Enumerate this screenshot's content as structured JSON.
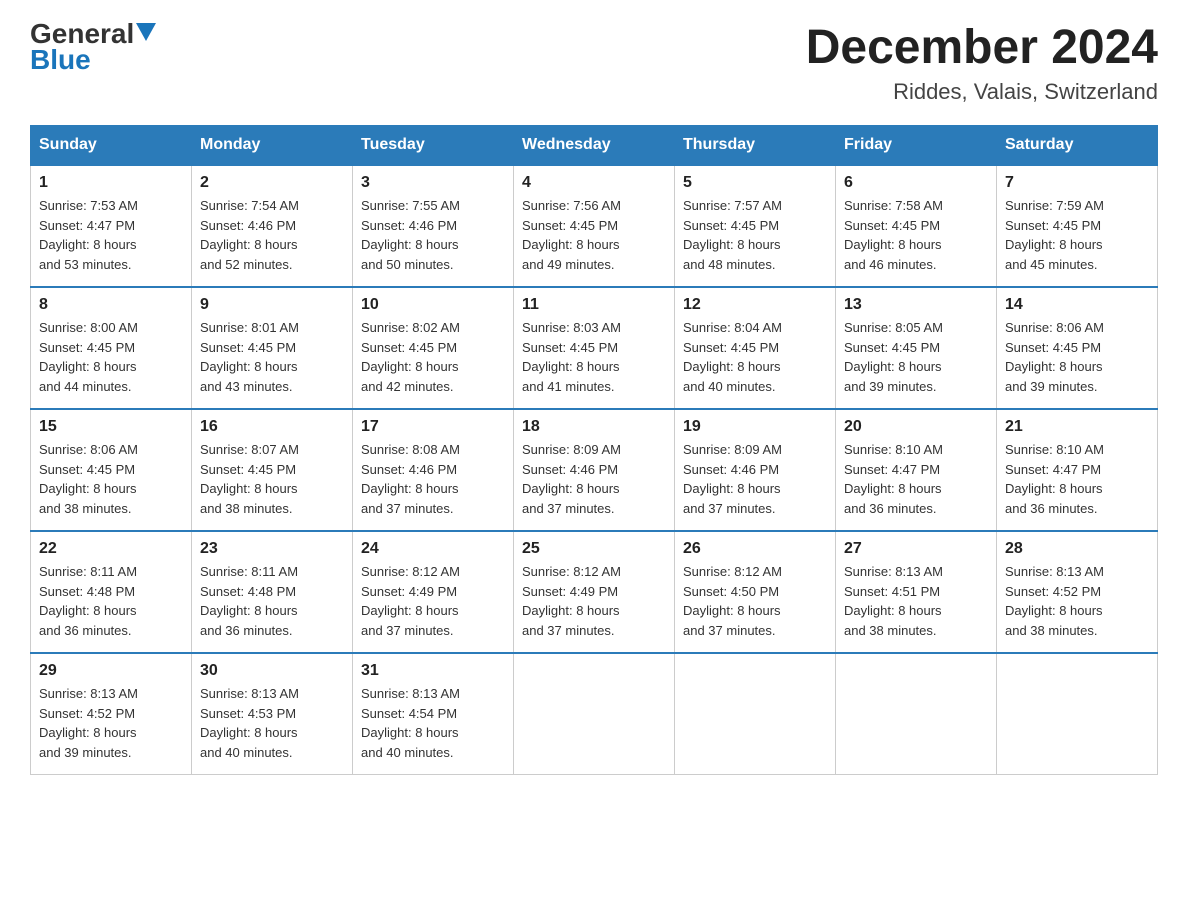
{
  "header": {
    "logo_general": "General",
    "logo_blue": "Blue",
    "month_title": "December 2024",
    "location": "Riddes, Valais, Switzerland"
  },
  "days_of_week": [
    "Sunday",
    "Monday",
    "Tuesday",
    "Wednesday",
    "Thursday",
    "Friday",
    "Saturday"
  ],
  "weeks": [
    [
      {
        "day": "1",
        "sunrise": "7:53 AM",
        "sunset": "4:47 PM",
        "daylight": "8 hours and 53 minutes."
      },
      {
        "day": "2",
        "sunrise": "7:54 AM",
        "sunset": "4:46 PM",
        "daylight": "8 hours and 52 minutes."
      },
      {
        "day": "3",
        "sunrise": "7:55 AM",
        "sunset": "4:46 PM",
        "daylight": "8 hours and 50 minutes."
      },
      {
        "day": "4",
        "sunrise": "7:56 AM",
        "sunset": "4:45 PM",
        "daylight": "8 hours and 49 minutes."
      },
      {
        "day": "5",
        "sunrise": "7:57 AM",
        "sunset": "4:45 PM",
        "daylight": "8 hours and 48 minutes."
      },
      {
        "day": "6",
        "sunrise": "7:58 AM",
        "sunset": "4:45 PM",
        "daylight": "8 hours and 46 minutes."
      },
      {
        "day": "7",
        "sunrise": "7:59 AM",
        "sunset": "4:45 PM",
        "daylight": "8 hours and 45 minutes."
      }
    ],
    [
      {
        "day": "8",
        "sunrise": "8:00 AM",
        "sunset": "4:45 PM",
        "daylight": "8 hours and 44 minutes."
      },
      {
        "day": "9",
        "sunrise": "8:01 AM",
        "sunset": "4:45 PM",
        "daylight": "8 hours and 43 minutes."
      },
      {
        "day": "10",
        "sunrise": "8:02 AM",
        "sunset": "4:45 PM",
        "daylight": "8 hours and 42 minutes."
      },
      {
        "day": "11",
        "sunrise": "8:03 AM",
        "sunset": "4:45 PM",
        "daylight": "8 hours and 41 minutes."
      },
      {
        "day": "12",
        "sunrise": "8:04 AM",
        "sunset": "4:45 PM",
        "daylight": "8 hours and 40 minutes."
      },
      {
        "day": "13",
        "sunrise": "8:05 AM",
        "sunset": "4:45 PM",
        "daylight": "8 hours and 39 minutes."
      },
      {
        "day": "14",
        "sunrise": "8:06 AM",
        "sunset": "4:45 PM",
        "daylight": "8 hours and 39 minutes."
      }
    ],
    [
      {
        "day": "15",
        "sunrise": "8:06 AM",
        "sunset": "4:45 PM",
        "daylight": "8 hours and 38 minutes."
      },
      {
        "day": "16",
        "sunrise": "8:07 AM",
        "sunset": "4:45 PM",
        "daylight": "8 hours and 38 minutes."
      },
      {
        "day": "17",
        "sunrise": "8:08 AM",
        "sunset": "4:46 PM",
        "daylight": "8 hours and 37 minutes."
      },
      {
        "day": "18",
        "sunrise": "8:09 AM",
        "sunset": "4:46 PM",
        "daylight": "8 hours and 37 minutes."
      },
      {
        "day": "19",
        "sunrise": "8:09 AM",
        "sunset": "4:46 PM",
        "daylight": "8 hours and 37 minutes."
      },
      {
        "day": "20",
        "sunrise": "8:10 AM",
        "sunset": "4:47 PM",
        "daylight": "8 hours and 36 minutes."
      },
      {
        "day": "21",
        "sunrise": "8:10 AM",
        "sunset": "4:47 PM",
        "daylight": "8 hours and 36 minutes."
      }
    ],
    [
      {
        "day": "22",
        "sunrise": "8:11 AM",
        "sunset": "4:48 PM",
        "daylight": "8 hours and 36 minutes."
      },
      {
        "day": "23",
        "sunrise": "8:11 AM",
        "sunset": "4:48 PM",
        "daylight": "8 hours and 36 minutes."
      },
      {
        "day": "24",
        "sunrise": "8:12 AM",
        "sunset": "4:49 PM",
        "daylight": "8 hours and 37 minutes."
      },
      {
        "day": "25",
        "sunrise": "8:12 AM",
        "sunset": "4:49 PM",
        "daylight": "8 hours and 37 minutes."
      },
      {
        "day": "26",
        "sunrise": "8:12 AM",
        "sunset": "4:50 PM",
        "daylight": "8 hours and 37 minutes."
      },
      {
        "day": "27",
        "sunrise": "8:13 AM",
        "sunset": "4:51 PM",
        "daylight": "8 hours and 38 minutes."
      },
      {
        "day": "28",
        "sunrise": "8:13 AM",
        "sunset": "4:52 PM",
        "daylight": "8 hours and 38 minutes."
      }
    ],
    [
      {
        "day": "29",
        "sunrise": "8:13 AM",
        "sunset": "4:52 PM",
        "daylight": "8 hours and 39 minutes."
      },
      {
        "day": "30",
        "sunrise": "8:13 AM",
        "sunset": "4:53 PM",
        "daylight": "8 hours and 40 minutes."
      },
      {
        "day": "31",
        "sunrise": "8:13 AM",
        "sunset": "4:54 PM",
        "daylight": "8 hours and 40 minutes."
      },
      null,
      null,
      null,
      null
    ]
  ],
  "labels": {
    "sunrise": "Sunrise:",
    "sunset": "Sunset:",
    "daylight": "Daylight:"
  }
}
